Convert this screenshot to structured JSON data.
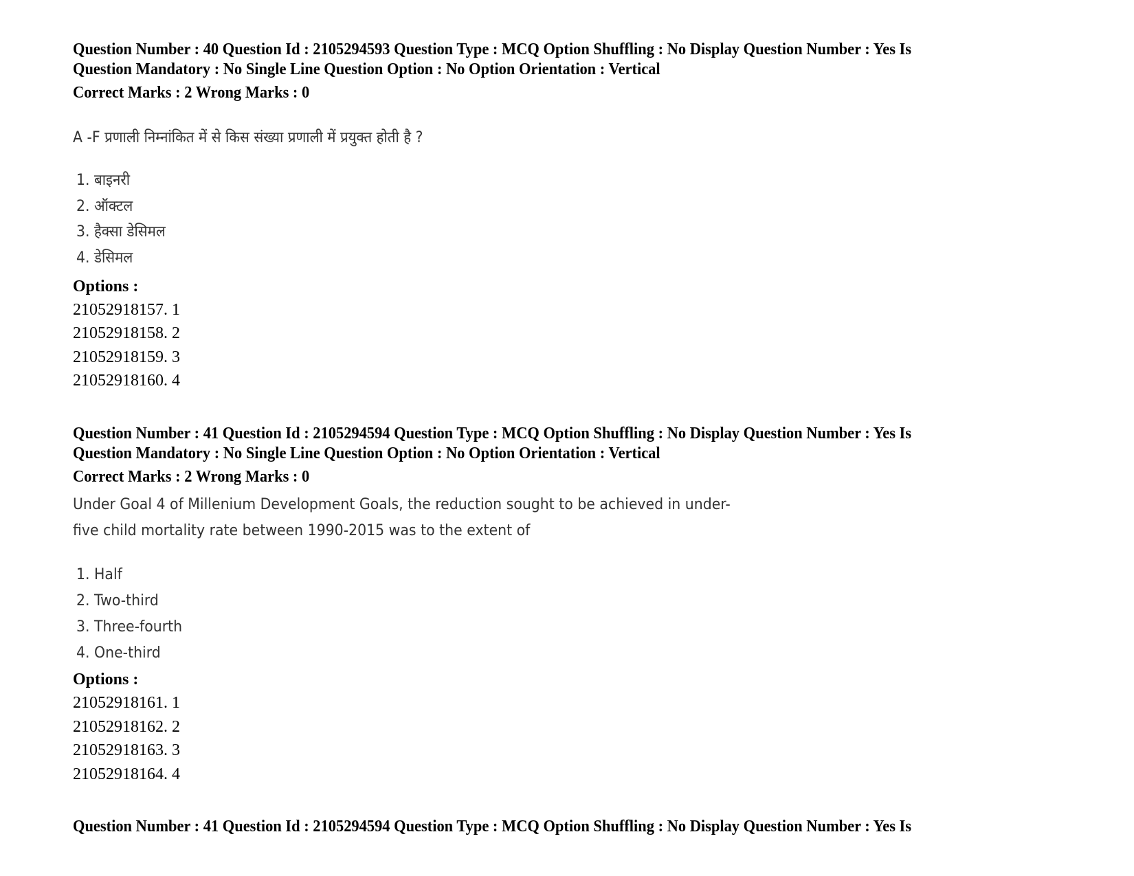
{
  "questions": [
    {
      "header_line1": "Question Number : 40 Question Id : 2105294593 Question Type : MCQ Option Shuffling : No Display Question Number : Yes Is",
      "header_line2": "Question Mandatory : No Single Line Question Option : No Option Orientation : Vertical",
      "marks": "Correct Marks : 2 Wrong Marks : 0",
      "question_lines": [
        "A -F प्रणाली निम्नांकित में से किस संख्या  प्रणाली में प्रयुक्त होती है ?"
      ],
      "choices": [
        "1. बाइनरी",
        "2. ऑक्टल",
        "3. हैक्सा डेसिमल",
        "4. डेसिमल"
      ],
      "options_label": "Options :",
      "option_ids": [
        "21052918157. 1",
        "21052918158. 2",
        "21052918159. 3",
        "21052918160. 4"
      ]
    },
    {
      "header_line1": "Question Number : 41 Question Id : 2105294594 Question Type : MCQ Option Shuffling : No Display Question Number : Yes Is",
      "header_line2": "Question Mandatory : No Single Line Question Option : No Option Orientation : Vertical",
      "marks": "Correct Marks : 2 Wrong Marks : 0",
      "question_lines": [
        "Under Goal 4 of Millenium Development Goals, the reduction sought to be achieved in under-",
        "five child mortality rate between 1990-2015 was to the extent of"
      ],
      "choices": [
        "1. Half",
        "2. Two-third",
        "3. Three-fourth",
        "4. One-third"
      ],
      "options_label": "Options :",
      "option_ids": [
        "21052918161. 1",
        "21052918162. 2",
        "21052918163. 3",
        "21052918164. 4"
      ]
    },
    {
      "header_line1": "Question Number : 41 Question Id : 2105294594 Question Type : MCQ Option Shuffling : No Display Question Number : Yes Is"
    }
  ]
}
